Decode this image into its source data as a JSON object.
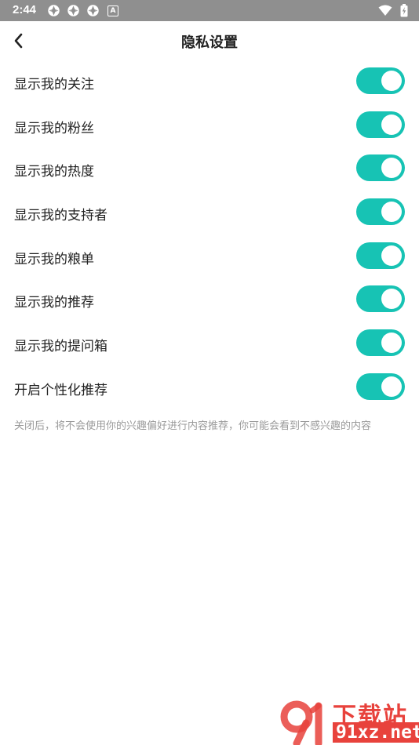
{
  "status_bar": {
    "time": "2:44",
    "notif_letter": "A"
  },
  "header": {
    "title": "隐私设置"
  },
  "settings": [
    {
      "label": "显示我的关注",
      "enabled": true
    },
    {
      "label": "显示我的粉丝",
      "enabled": true
    },
    {
      "label": "显示我的热度",
      "enabled": true
    },
    {
      "label": "显示我的支持者",
      "enabled": true
    },
    {
      "label": "显示我的粮单",
      "enabled": true
    },
    {
      "label": "显示我的推荐",
      "enabled": true
    },
    {
      "label": "显示我的提问箱",
      "enabled": true
    },
    {
      "label": "开启个性化推荐",
      "enabled": true
    }
  ],
  "footnote": "关闭后，将不会使用你的兴趣偏好进行内容推荐，你可能会看到不感兴趣的内容",
  "watermark": {
    "top": "下载站",
    "bottom": "91xz.net"
  },
  "colors": {
    "toggle_on": "#17c3b4",
    "status_bar": "#8f8f8f",
    "footnote": "#9a9a9a",
    "watermark": "#e8423c"
  }
}
